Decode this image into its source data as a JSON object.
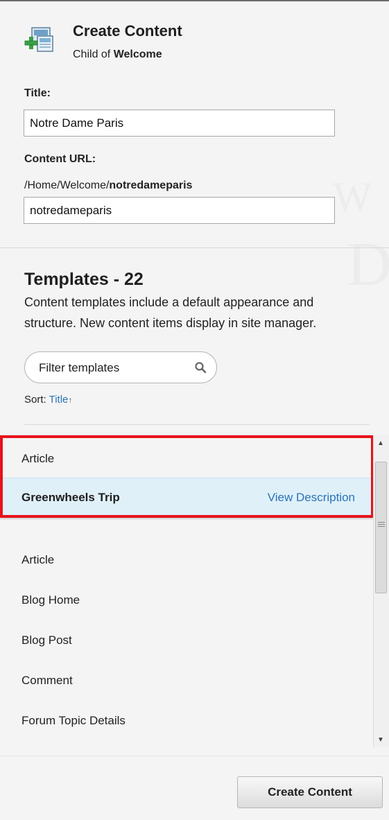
{
  "header": {
    "title": "Create Content",
    "subtitle_prefix": "Child of ",
    "subtitle_parent": "Welcome",
    "icon": "create-content-icon"
  },
  "form": {
    "title_label": "Title:",
    "title_value": "Notre Dame Paris",
    "url_label": "Content URL:",
    "url_path_prefix": "/Home/Welcome/",
    "url_path_slug": "notredameparis",
    "url_value": "notredameparis"
  },
  "templates": {
    "heading": "Templates - 22",
    "description": "Content templates include a default appearance and structure. New content items display in site manager.",
    "filter_placeholder": "Filter templates",
    "sort_label": "Sort:",
    "sort_value": "Title",
    "sort_arrow": "↑",
    "view_description_label": "View Description",
    "items": [
      {
        "label": "Article"
      },
      {
        "label": "Greenwheels Trip",
        "selected": true
      },
      {
        "label": "Article"
      },
      {
        "label": "Blog Home"
      },
      {
        "label": "Blog Post"
      },
      {
        "label": "Comment"
      },
      {
        "label": "Forum Topic Details"
      }
    ]
  },
  "footer": {
    "create_button_label": "Create Content"
  },
  "colors": {
    "accent_link": "#2a73b8",
    "selected_row": "#dff0f8",
    "highlight_border": "#e8121b"
  }
}
